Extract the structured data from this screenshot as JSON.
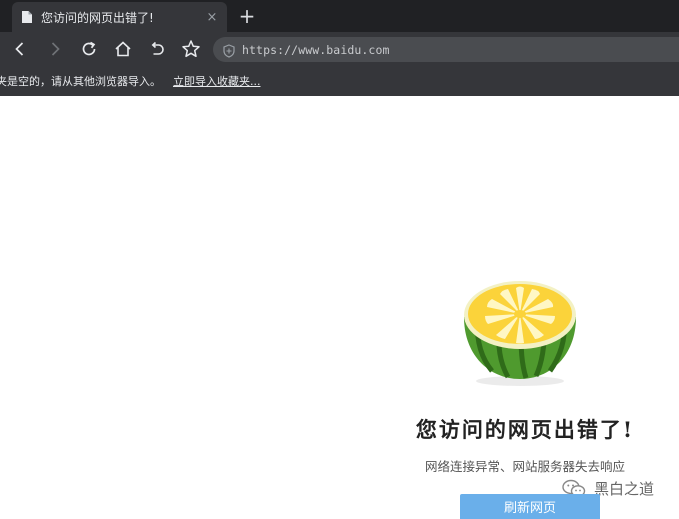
{
  "browser": {
    "tab": {
      "title": "您访问的网页出错了!",
      "icon": "page-icon",
      "close_label": "×"
    },
    "new_tab_label": "+",
    "toolbar": {
      "icons": [
        "back-icon",
        "forward-icon",
        "reload-icon",
        "home-icon",
        "undo-icon",
        "star-icon"
      ],
      "url": "https://www.baidu.com",
      "security_icon": "shield-icon"
    },
    "bookmarks_bar": {
      "message": "夹是空的，请从其他浏览器导入。",
      "import_link": "立即导入收藏夹..."
    }
  },
  "error_page": {
    "illustration": "watermelon-icon",
    "title": "您访问的网页出错了!",
    "subtitle": "网络连接异常、网站服务器失去响应",
    "refresh_button": "刷新网页"
  },
  "watermark": {
    "text": "黑白之道",
    "icon": "wechat-icon"
  },
  "colors": {
    "tab_strip": "#202124",
    "toolbar": "#35363a",
    "omnibox": "#4a4c50",
    "refresh_button": "#6aafea",
    "melon_rind": "#4f9a2e",
    "melon_flesh": "#fbd33a"
  }
}
